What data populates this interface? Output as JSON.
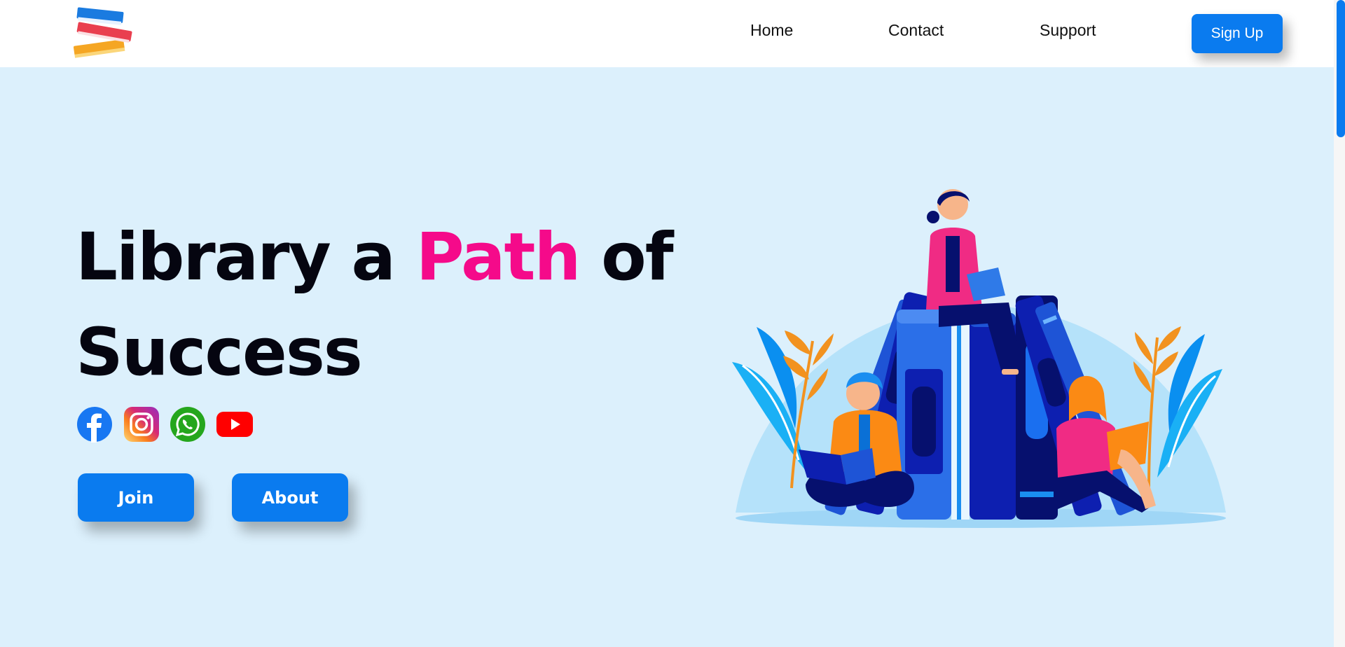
{
  "header": {
    "logo_icon": "stacked-books-icon",
    "nav": {
      "home": "Home",
      "contact": "Contact",
      "support": "Support"
    },
    "signup_label": "Sign Up"
  },
  "hero": {
    "headline": {
      "part1": "Library a",
      "accent": "Path",
      "part2": "of",
      "line2": "Success"
    },
    "social_icons": [
      "facebook-icon",
      "instagram-icon",
      "whatsapp-icon",
      "youtube-icon"
    ],
    "buttons": {
      "join": "Join",
      "about": "About"
    },
    "illustration_icon": "people-reading-books-illustration"
  },
  "colors": {
    "accent": "#0a7bef",
    "highlight": "#f50a8a",
    "hero_background": "#dcf0fc"
  }
}
